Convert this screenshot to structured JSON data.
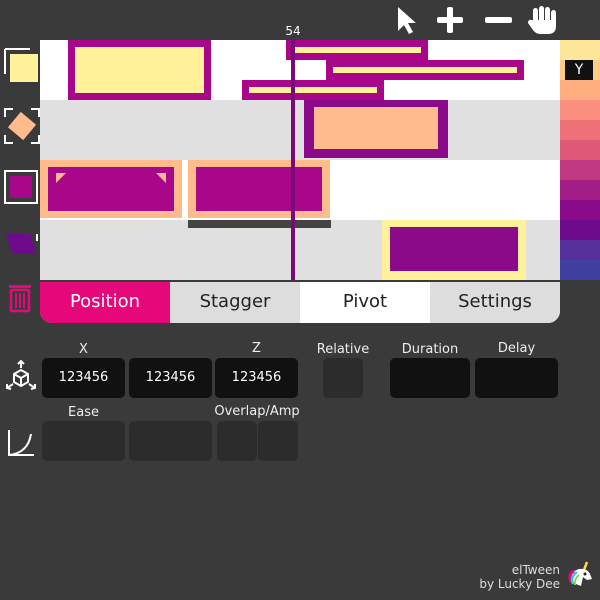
{
  "toolbar": {
    "tools": [
      "pointer-icon",
      "plus-icon",
      "minus-icon",
      "hand-icon"
    ]
  },
  "left_tools": [
    "square-icon",
    "rotate-icon",
    "fill-square-icon",
    "skew-icon",
    "trash-icon"
  ],
  "timeline": {
    "playhead_label": "54",
    "axis_badge": "Y",
    "colors": {
      "lane_white": "#ffffff",
      "lane_gray": "#e0e0e0",
      "magenta": "#a8078a",
      "purple": "#8a0a8a",
      "peach": "#ffbb8c",
      "yellow": "#fff29a",
      "playhead": "#7a0a7a"
    }
  },
  "palette": [
    "#ffe79a",
    "#ffcc88",
    "#ffae80",
    "#fc9080",
    "#f07078",
    "#e05878",
    "#c03a82",
    "#a21e86",
    "#8a0c8a",
    "#6e0a8c",
    "#55309a",
    "#4040a0"
  ],
  "tabs": [
    {
      "label": "Position",
      "active": true
    },
    {
      "label": "Stagger",
      "active": false
    },
    {
      "label": "Pivot",
      "active": false
    },
    {
      "label": "Settings",
      "active": false
    }
  ],
  "tab_colors": {
    "active_bg": "#e6087a",
    "active_fg": "#ffffff",
    "bg": "#dddddd",
    "pivot_bg": "#ffffff"
  },
  "inputs": {
    "x_label": "X",
    "z_label": "Z",
    "x_value": "123456",
    "y_value": "123456",
    "z_value": "123456",
    "relative_label": "Relative",
    "duration_label": "Duration",
    "delay_label": "Delay",
    "ease_label": "Ease",
    "overlap_label": "Overlap/Amp"
  },
  "credits": {
    "line1": "elTween",
    "line2": "by Lucky Dee"
  }
}
